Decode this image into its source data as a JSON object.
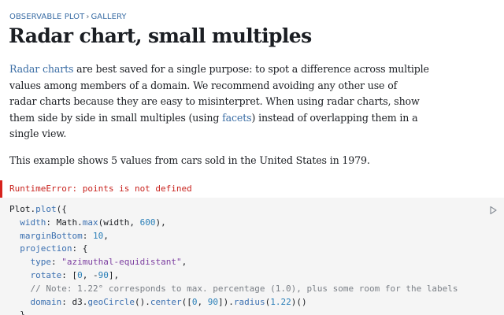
{
  "breadcrumb": {
    "root": "OBSERVABLE PLOT",
    "separator": "›",
    "current": "GALLERY"
  },
  "title": "Radar chart, small multiples",
  "intro": {
    "link1": "Radar charts",
    "text_a": " are best saved for a single purpose: to spot a difference across multiple",
    "line2": "values among members of a domain. We recommend avoiding any other use of",
    "line3": "radar charts because they are easy to misinterpret. When using radar charts, show",
    "text_b": "them side by side in small multiples (using ",
    "link2": "facets",
    "text_c": ") instead of overlapping them in a",
    "line5": "single view."
  },
  "description": "This example shows 5 values from cars sold in the United States in 1979.",
  "error": "RuntimeError: points is not defined",
  "code_lines": [
    "Plot.plot({",
    "  width: Math.max(width, 600),",
    "  marginBottom: 10,",
    "  projection: {",
    "    type: \"azimuthal-equidistant\",",
    "    rotate: [0, -90],",
    "    // Note: 1.22° corresponds to max. percentage (1.0), plus some room for the labels",
    "    domain: d3.geoCircle().center([0, 90]).radius(1.22)()",
    "  },"
  ],
  "icons": {
    "run": "play-icon"
  },
  "colors": {
    "link": "#3b6ea5",
    "error": "#c8231e",
    "error_bar": "#d6221d",
    "code_bg": "#f5f5f5"
  }
}
